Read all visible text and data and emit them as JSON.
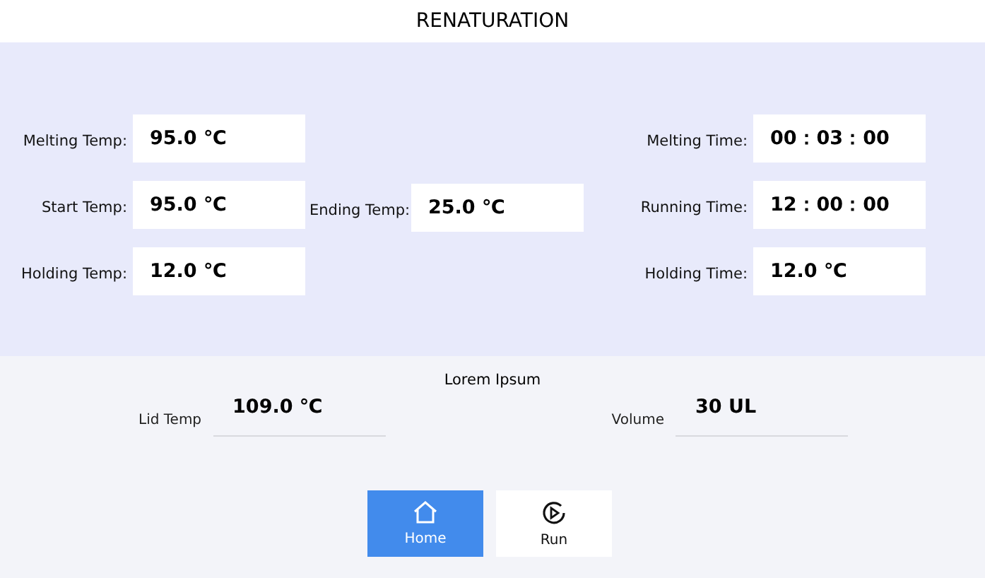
{
  "window": {
    "title": "RENATURATION"
  },
  "left_fields": [
    {
      "label": "Melting Temp:",
      "value": "95.0 ℃"
    },
    {
      "label": "Start Temp:",
      "value": "95.0 ℃"
    },
    {
      "label": "Holding Temp:",
      "value": "12.0 ℃"
    }
  ],
  "middle_fields": [
    {
      "label": "Ending Temp:",
      "value": "25.0 ℃"
    }
  ],
  "right_fields": [
    {
      "label": "Melting Time:",
      "value": "00：03：00"
    },
    {
      "label": "Running Time:",
      "value": "12：00：00"
    },
    {
      "label": "Holding Time:",
      "value": "12.0 ℃"
    }
  ],
  "section_title": "Lorem Ipsum",
  "lid": {
    "label": "Lid Temp",
    "value": "109.0 ℃"
  },
  "volume": {
    "label": "Volume",
    "value": "30 UL"
  },
  "buttons": [
    {
      "label": "Home",
      "kind": "home",
      "selected": true
    },
    {
      "label": "Run",
      "kind": "run",
      "selected": false
    }
  ]
}
